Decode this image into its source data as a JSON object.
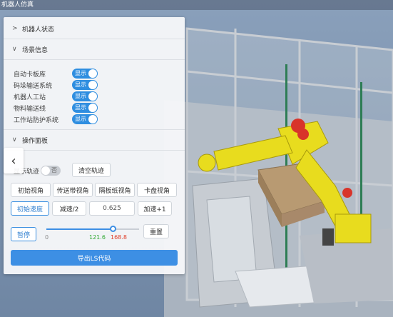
{
  "window": {
    "title": "机器人仿真"
  },
  "panel": {
    "robot_status": {
      "title": "机器人状态"
    },
    "scene_info": {
      "title": "场景信息",
      "items": [
        {
          "label": "自动卡板库",
          "toggle": "显示"
        },
        {
          "label": "码垛输送系统",
          "toggle": "显示"
        },
        {
          "label": "机器人工站",
          "toggle": "显示"
        },
        {
          "label": "物料输送线",
          "toggle": "显示"
        },
        {
          "label": "工作站防护系统",
          "toggle": "显示"
        }
      ]
    },
    "control": {
      "title": "操作面板",
      "trajectory": {
        "label": "显示轨迹",
        "toggle": "否",
        "clear_button": "清空轨迹"
      },
      "views": [
        "初始视角",
        "传送带视角",
        "隔板纸视角",
        "卡盘视角"
      ],
      "speed": {
        "reset": "初始速度",
        "decrease": "减速/2",
        "value": "0.625",
        "increase": "加速+1"
      },
      "playback": {
        "pause": "暂停",
        "slider_min": "0",
        "current": "121.6",
        "max": "168.8",
        "progress": 0.72,
        "reset": "重置"
      },
      "export_button": "导出LS代码"
    },
    "collapse_icon": "chevron-left-icon"
  },
  "colors": {
    "accent": "#3d8fe4",
    "robot": "#e8dc1e",
    "current_value": "#2fa82f",
    "max_value": "#e0402a"
  }
}
